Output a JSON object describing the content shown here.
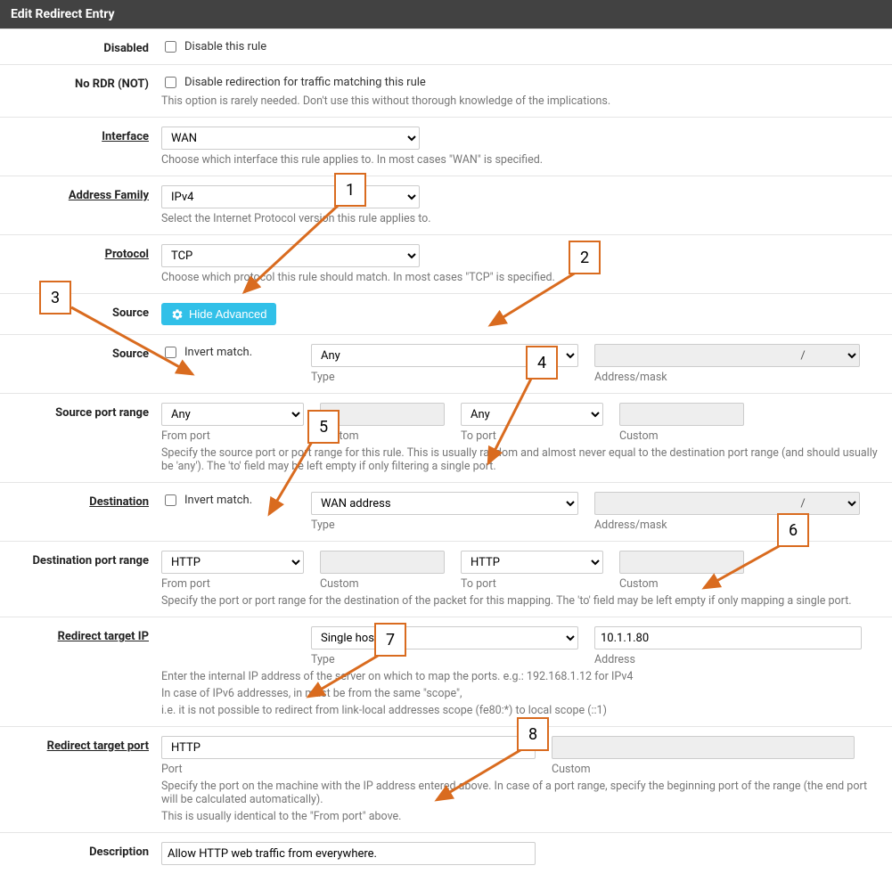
{
  "panel": {
    "title": "Edit Redirect Entry"
  },
  "disabled": {
    "label": "Disabled",
    "chk_label": "Disable this rule"
  },
  "nordr": {
    "label": "No RDR (NOT)",
    "chk_label": "Disable redirection for traffic matching this rule",
    "help": "This option is rarely needed. Don't use this without thorough knowledge of the implications."
  },
  "interface": {
    "label": "Interface",
    "value": "WAN",
    "help": "Choose which interface this rule applies to. In most cases \"WAN\" is specified."
  },
  "addrfam": {
    "label": "Address Family",
    "value": "IPv4",
    "help": "Select the Internet Protocol version this rule applies to."
  },
  "protocol": {
    "label": "Protocol",
    "value": "TCP",
    "help": "Choose which protocol this rule should match. In most cases \"TCP\" is specified."
  },
  "source_btn_row": {
    "label": "Source",
    "button": "Hide Advanced"
  },
  "source": {
    "label": "Source",
    "invert": "Invert match.",
    "type_value": "Any",
    "type_sub": "Type",
    "mask_sub": "Address/mask",
    "slash": "/"
  },
  "src_port_range": {
    "label": "Source port range",
    "from_value": "Any",
    "from_sub": "From port",
    "from_custom_sub": "Custom",
    "to_value": "Any",
    "to_sub": "To port",
    "to_custom_sub": "Custom",
    "help": "Specify the source port or port range for this rule. This is usually random and almost never equal to the destination port range (and should usually be 'any'). The 'to' field may be left empty if only filtering a single port."
  },
  "destination": {
    "label": "Destination",
    "invert": "Invert match.",
    "type_value": "WAN address",
    "type_sub": "Type",
    "mask_sub": "Address/mask",
    "slash": "/"
  },
  "dst_port_range": {
    "label": "Destination port range",
    "from_value": "HTTP",
    "from_sub": "From port",
    "from_custom_sub": "Custom",
    "to_value": "HTTP",
    "to_sub": "To port",
    "to_custom_sub": "Custom",
    "help": "Specify the port or port range for the destination of the packet for this mapping. The 'to' field may be left empty if only mapping a single port."
  },
  "redirect_ip": {
    "label": "Redirect target IP",
    "type_value": "Single host",
    "type_sub": "Type",
    "addr_value": "10.1.1.80",
    "addr_sub": "Address",
    "help1": "Enter the internal IP address of the server on which to map the ports. e.g.: 192.168.1.12 for IPv4",
    "help2": "In case of IPv6 addresses, in must be from the same \"scope\",",
    "help3": "i.e. it is not possible to redirect from link-local addresses scope (fe80:*) to local scope (::1)"
  },
  "redirect_port": {
    "label": "Redirect target port",
    "port_value": "HTTP",
    "port_sub": "Port",
    "custom_sub": "Custom",
    "help1": "Specify the port on the machine with the IP address entered above. In case of a port range, specify the beginning port of the range (the end port will be calculated automatically).",
    "help2": "This is usually identical to the \"From port\" above."
  },
  "description": {
    "label": "Description",
    "value": "Allow HTTP web traffic from everywhere."
  },
  "callouts": [
    "1",
    "2",
    "3",
    "4",
    "5",
    "6",
    "7",
    "8"
  ]
}
